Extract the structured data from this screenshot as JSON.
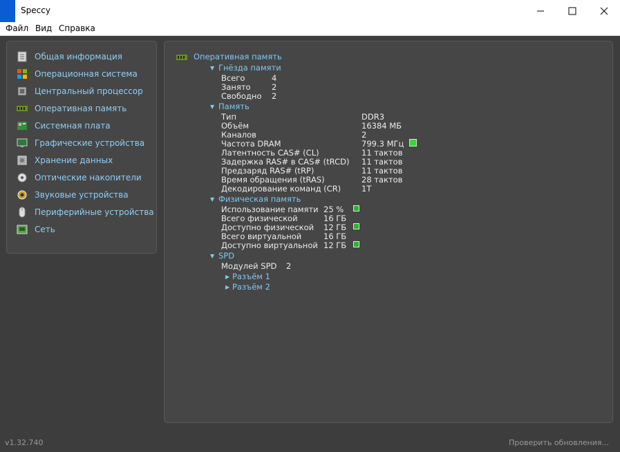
{
  "window": {
    "title": "Speccy"
  },
  "menu": {
    "file": "Файл",
    "view": "Вид",
    "help": "Справка"
  },
  "sidebar": {
    "items": [
      {
        "label": "Общая информация"
      },
      {
        "label": "Операционная система"
      },
      {
        "label": "Центральный процессор"
      },
      {
        "label": "Оперативная память"
      },
      {
        "label": "Системная плата"
      },
      {
        "label": "Графические устройства"
      },
      {
        "label": "Хранение данных"
      },
      {
        "label": "Оптические накопители"
      },
      {
        "label": "Звуковые устройства"
      },
      {
        "label": "Периферийные устройства"
      },
      {
        "label": "Сеть"
      }
    ]
  },
  "main": {
    "title": "Оперативная память",
    "slots": {
      "header": "Гнёзда памяти",
      "rows": [
        {
          "label": "Всего",
          "value": "4"
        },
        {
          "label": "Занято",
          "value": "2"
        },
        {
          "label": "Свободно",
          "value": "2"
        }
      ]
    },
    "memory": {
      "header": "Память",
      "rows": [
        {
          "label": "Тип",
          "value": "DDR3"
        },
        {
          "label": "Объём",
          "value": "16384 МБ"
        },
        {
          "label": "Каналов",
          "value": "2"
        },
        {
          "label": "Частота DRAM",
          "value": "799.3 МГц"
        },
        {
          "label": "Латентность CAS# (CL)",
          "value": "11 тактов"
        },
        {
          "label": "Задержка RAS# в CAS# (tRCD)",
          "value": "11 тактов"
        },
        {
          "label": "Предзаряд RAS# (tRP)",
          "value": "11 тактов"
        },
        {
          "label": "Время обращения (tRAS)",
          "value": "28 тактов"
        },
        {
          "label": "Декодирование команд (CR)",
          "value": "1T"
        }
      ]
    },
    "physical": {
      "header": "Физическая память",
      "rows": [
        {
          "label": "Использование памяти",
          "value": "25 %"
        },
        {
          "label": "Всего физической",
          "value": "16 ГБ"
        },
        {
          "label": "Доступно физической",
          "value": "12 ГБ"
        },
        {
          "label": "Всего виртуальной",
          "value": "16 ГБ"
        },
        {
          "label": "Доступно виртуальной",
          "value": "12 ГБ"
        }
      ]
    },
    "spd": {
      "header": "SPD",
      "modules_label": "Модулей SPD",
      "modules_value": "2",
      "slot1": "Разъём 1",
      "slot2": "Разъём 2"
    }
  },
  "status": {
    "version": "v1.32.740",
    "update": "Проверить обновления..."
  },
  "colors": {
    "accent": "#7fc9f0",
    "indicator": "#3bd43b",
    "background": "#3d3d3d"
  }
}
